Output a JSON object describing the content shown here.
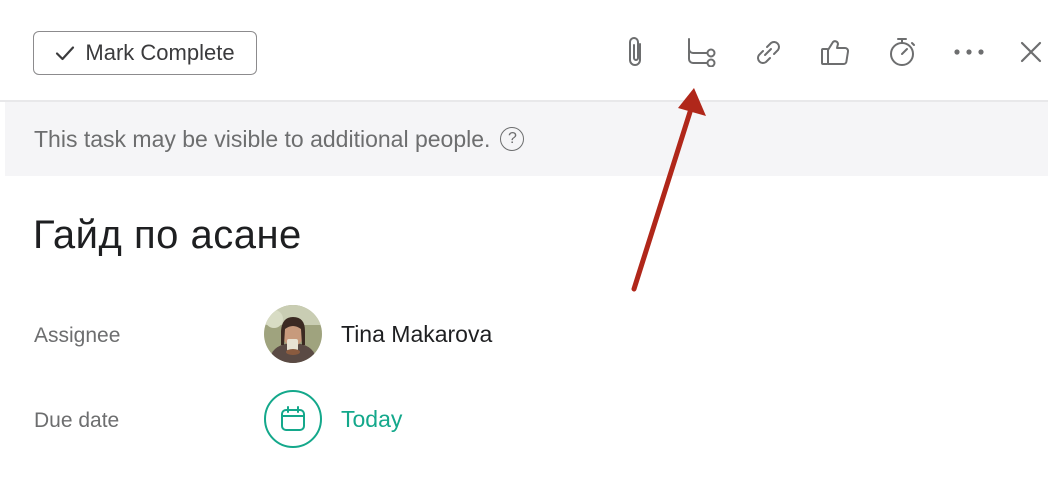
{
  "toolbar": {
    "mark_complete_label": "Mark Complete",
    "icons": [
      "paperclip-icon",
      "subtask-icon",
      "link-icon",
      "thumbs-up-icon",
      "stopwatch-icon",
      "more-icon",
      "close-icon"
    ]
  },
  "banner": {
    "text": "This task may be visible to additional people.",
    "help_glyph": "?"
  },
  "task": {
    "title": "Гайд по асане",
    "assignee_label": "Assignee",
    "assignee_name": "Tina Makarova",
    "due_label": "Due date",
    "due_value": "Today"
  },
  "colors": {
    "accent": "#14a88b",
    "annotation_arrow": "#b0271a",
    "text_secondary": "#6d6e6f"
  }
}
